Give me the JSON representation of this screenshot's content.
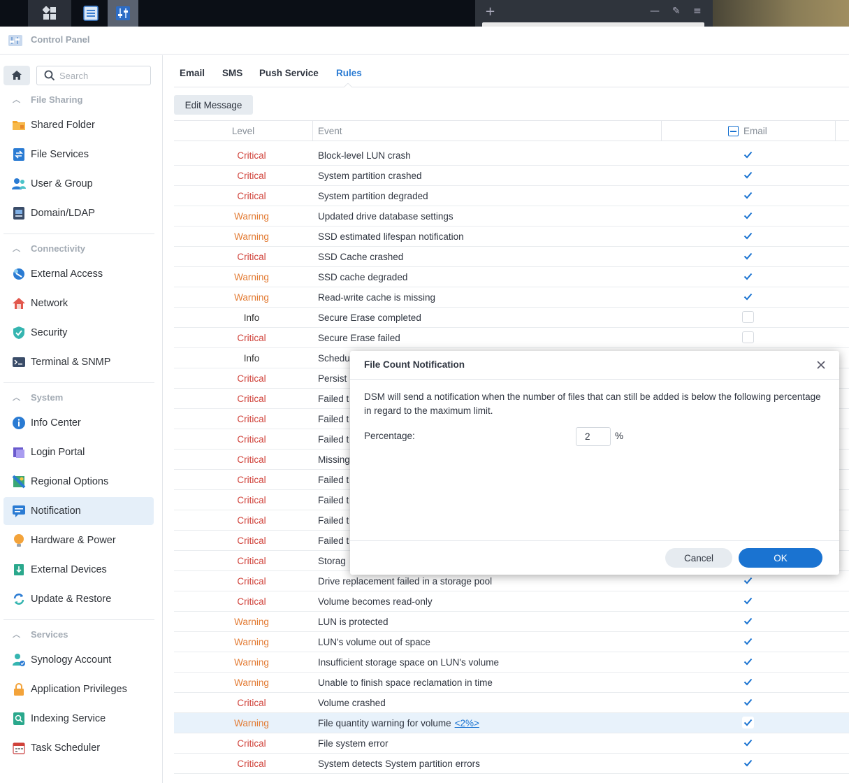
{
  "window": {
    "title": "Control Panel"
  },
  "search": {
    "placeholder": "Search"
  },
  "sidebar": {
    "groups": [
      {
        "label": "File Sharing",
        "items": [
          {
            "label": "Shared Folder",
            "icon": "folder-icon"
          },
          {
            "label": "File Services",
            "icon": "file-services-icon"
          },
          {
            "label": "User & Group",
            "icon": "users-icon"
          },
          {
            "label": "Domain/LDAP",
            "icon": "domain-icon"
          }
        ]
      },
      {
        "label": "Connectivity",
        "items": [
          {
            "label": "External Access",
            "icon": "external-access-icon"
          },
          {
            "label": "Network",
            "icon": "network-home-icon"
          },
          {
            "label": "Security",
            "icon": "shield-icon"
          },
          {
            "label": "Terminal & SNMP",
            "icon": "terminal-icon"
          }
        ]
      },
      {
        "label": "System",
        "items": [
          {
            "label": "Info Center",
            "icon": "info-icon"
          },
          {
            "label": "Login Portal",
            "icon": "login-portal-icon"
          },
          {
            "label": "Regional Options",
            "icon": "regional-options-icon"
          },
          {
            "label": "Notification",
            "icon": "notification-icon",
            "active": true
          },
          {
            "label": "Hardware & Power",
            "icon": "lightbulb-icon"
          },
          {
            "label": "External Devices",
            "icon": "external-devices-icon"
          },
          {
            "label": "Update & Restore",
            "icon": "update-restore-icon"
          }
        ]
      },
      {
        "label": "Services",
        "items": [
          {
            "label": "Synology Account",
            "icon": "synology-account-icon"
          },
          {
            "label": "Application Privileges",
            "icon": "lock-icon"
          },
          {
            "label": "Indexing Service",
            "icon": "indexing-icon"
          },
          {
            "label": "Task Scheduler",
            "icon": "calendar-icon"
          }
        ]
      }
    ]
  },
  "tabs": [
    "Email",
    "SMS",
    "Push Service",
    "Rules"
  ],
  "active_tab": "Rules",
  "toolbar": {
    "edit_message": "Edit Message"
  },
  "grid": {
    "columns": {
      "level": "Level",
      "event": "Event",
      "email": "Email"
    },
    "rows": [
      {
        "level": "Critical",
        "event": "Block-level LUN crash",
        "email": true
      },
      {
        "level": "Critical",
        "event": "System partition crashed",
        "email": true
      },
      {
        "level": "Critical",
        "event": "System partition degraded",
        "email": true
      },
      {
        "level": "Warning",
        "event": "Updated drive database settings",
        "email": true
      },
      {
        "level": "Warning",
        "event": "SSD estimated lifespan notification",
        "email": true
      },
      {
        "level": "Critical",
        "event": "SSD Cache crashed",
        "email": true
      },
      {
        "level": "Warning",
        "event": "SSD cache degraded",
        "email": true
      },
      {
        "level": "Warning",
        "event": "Read-write cache is missing",
        "email": true
      },
      {
        "level": "Info",
        "event": "Secure Erase completed",
        "email": false
      },
      {
        "level": "Critical",
        "event": "Secure Erase failed",
        "email": false
      },
      {
        "level": "Info",
        "event": "Schedu",
        "email": false
      },
      {
        "level": "Critical",
        "event": "Persist",
        "email": true
      },
      {
        "level": "Critical",
        "event": "Failed t",
        "email": true
      },
      {
        "level": "Critical",
        "event": "Failed t",
        "email": true
      },
      {
        "level": "Critical",
        "event": "Failed t",
        "email": true
      },
      {
        "level": "Critical",
        "event": "Missing",
        "email": true
      },
      {
        "level": "Critical",
        "event": "Failed t",
        "email": true
      },
      {
        "level": "Critical",
        "event": "Failed t",
        "email": true
      },
      {
        "level": "Critical",
        "event": "Failed t",
        "email": true
      },
      {
        "level": "Critical",
        "event": "Failed t",
        "email": true
      },
      {
        "level": "Critical",
        "event": "Storag",
        "email": true
      },
      {
        "level": "Critical",
        "event": "Drive replacement failed in a storage pool",
        "email": true
      },
      {
        "level": "Critical",
        "event": "Volume becomes read-only",
        "email": true
      },
      {
        "level": "Warning",
        "event": "LUN is protected",
        "email": true
      },
      {
        "level": "Warning",
        "event": "LUN's volume out of space",
        "email": true
      },
      {
        "level": "Warning",
        "event": "Insufficient storage space on LUN's volume",
        "email": true
      },
      {
        "level": "Warning",
        "event": "Unable to finish space reclamation in time",
        "email": true
      },
      {
        "level": "Critical",
        "event": "Volume crashed",
        "email": true
      },
      {
        "level": "Warning",
        "event": "File quantity warning for volume",
        "link": "<2%>",
        "email": true,
        "highlight": true
      },
      {
        "level": "Critical",
        "event": "File system error",
        "email": true
      },
      {
        "level": "Critical",
        "event": "System detects System partition errors",
        "email": true
      }
    ]
  },
  "dialog": {
    "title": "File Count Notification",
    "description": "DSM will send a notification when the number of files that can still be added is below the following percentage in regard to the maximum limit.",
    "percentage_label": "Percentage:",
    "percentage_value": "2",
    "percentage_unit": "%",
    "cancel": "Cancel",
    "ok": "OK"
  },
  "colors": {
    "accent": "#1a73d1",
    "critical": "#d0423a",
    "warning": "#e27a32",
    "active_nav_bg": "#e5eff9"
  }
}
